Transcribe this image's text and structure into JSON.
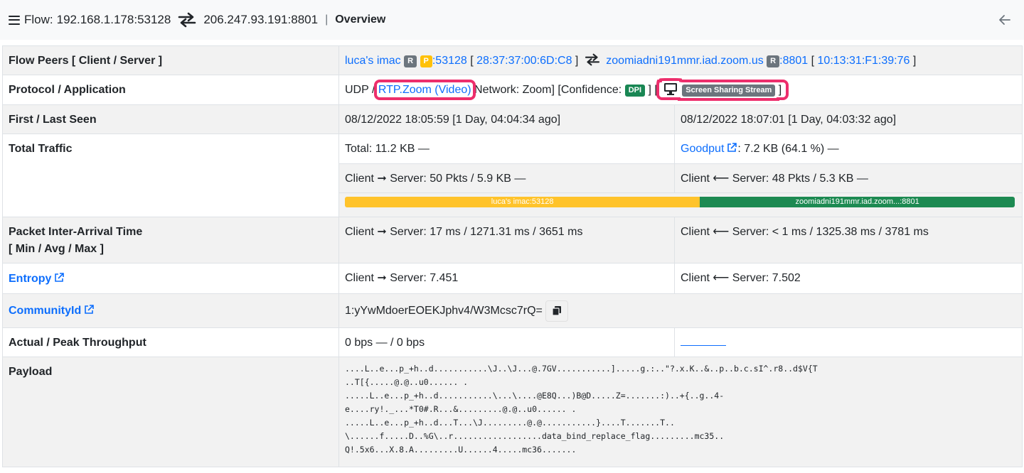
{
  "topbar": {
    "flow_label": "Flow:",
    "client": "192.168.1.178:53128",
    "server": "206.247.93.191:8801",
    "separator": "|",
    "title": "Overview"
  },
  "rows": {
    "peers": {
      "label": "Flow Peers [ Client / Server ]",
      "client_name": "luca's imac",
      "client_badge_r": "R",
      "client_badge_p": "P",
      "client_port": ":53128",
      "client_mac_open": "[",
      "client_mac": "28:37:37:00:6D:C8",
      "client_mac_close": "]",
      "server_name": "zoomiadni191mmr.iad.zoom.us",
      "server_badge_r": "R",
      "server_port": ":8801",
      "server_mac_open": "[",
      "server_mac": "10:13:31:F1:39:76",
      "server_mac_close": "]"
    },
    "protocol": {
      "label": "Protocol / Application",
      "l4": "UDP /",
      "app": "RTP.Zoom (Video)",
      "network": "Network: Zoom] [Confidence:",
      "dpi_badge": "DPI",
      "open_bracket": "] [",
      "stream_badge": "Screen Sharing Stream",
      "close_bracket": "]"
    },
    "seen": {
      "label": "First / Last Seen",
      "first": "08/12/2022 18:05:59 [1 Day, 04:04:34 ago]",
      "last": "08/12/2022 18:07:01 [1 Day, 04:03:32 ago]"
    },
    "traffic": {
      "label": "Total Traffic",
      "total": "Total: 11.2 KB —",
      "goodput_link": "Goodput",
      "goodput_value": ": 7.2 KB (64.1 %) —",
      "c2s": "Client ➞ Server: 50 Pkts / 5.9 KB —",
      "s2c": "Client ⟵ Server: 48 Pkts / 5.3 KB —",
      "bar_client_label": "luca's imac:53128",
      "bar_client_pct": 53,
      "bar_server_label": "zoomiadni191mmr.iad.zoom...:8801",
      "bar_server_pct": 47,
      "bar_client_color": "#ffc32b",
      "bar_server_color": "#1d8a52"
    },
    "iat": {
      "label_line1": "Packet Inter-Arrival Time",
      "label_line2": "[ Min / Avg / Max ]",
      "c2s": "Client ➞ Server: 17 ms / 1271.31 ms / 3651 ms",
      "s2c": "Client ⟵ Server: < 1 ms / 1325.38 ms / 3781 ms"
    },
    "entropy": {
      "label": "Entropy",
      "c2s": "Client ➞ Server: 7.451",
      "s2c": "Client ⟵ Server: 7.502"
    },
    "community": {
      "label": "CommunityId",
      "value": "1:yYwMdoerEOEKJphv4/W3Mcsc7rQ="
    },
    "throughput": {
      "label": "Actual / Peak Throughput",
      "value": "0 bps — / 0 bps"
    },
    "payload": {
      "label": "Payload",
      "lines": [
        "....L..e...p_+h..d...........\\J..\\J...@.7GV...........].....g.:..\"?.x.K..&..p..b.c.sI^.r8..d$V{T",
        "..T[{.....@.@..u0...... .",
        ".....L..e...p_+h..d...........\\...\\....@E8Q...)B@D.....Z=.......:)..+{..g..4-",
        "e....ry!._...*T0#.R...&.........@.@..u0...... .",
        ".....L..e...p_+h..d...T...\\J.........@.@...........}....T.......T..",
        "\\......f.....D..%G\\..r..................data_bind_replace_flag.........mc35..",
        "Q!.5x6...X.8.A.........U......4.....mc36......."
      ]
    }
  },
  "colors": {
    "highlight": "#ed2e6c",
    "link": "#0d6efd"
  },
  "icons": [
    "hamburger-icon",
    "swap-arrows-icon",
    "back-arrow-icon",
    "external-link-icon",
    "monitor-icon",
    "copy-icon"
  ]
}
